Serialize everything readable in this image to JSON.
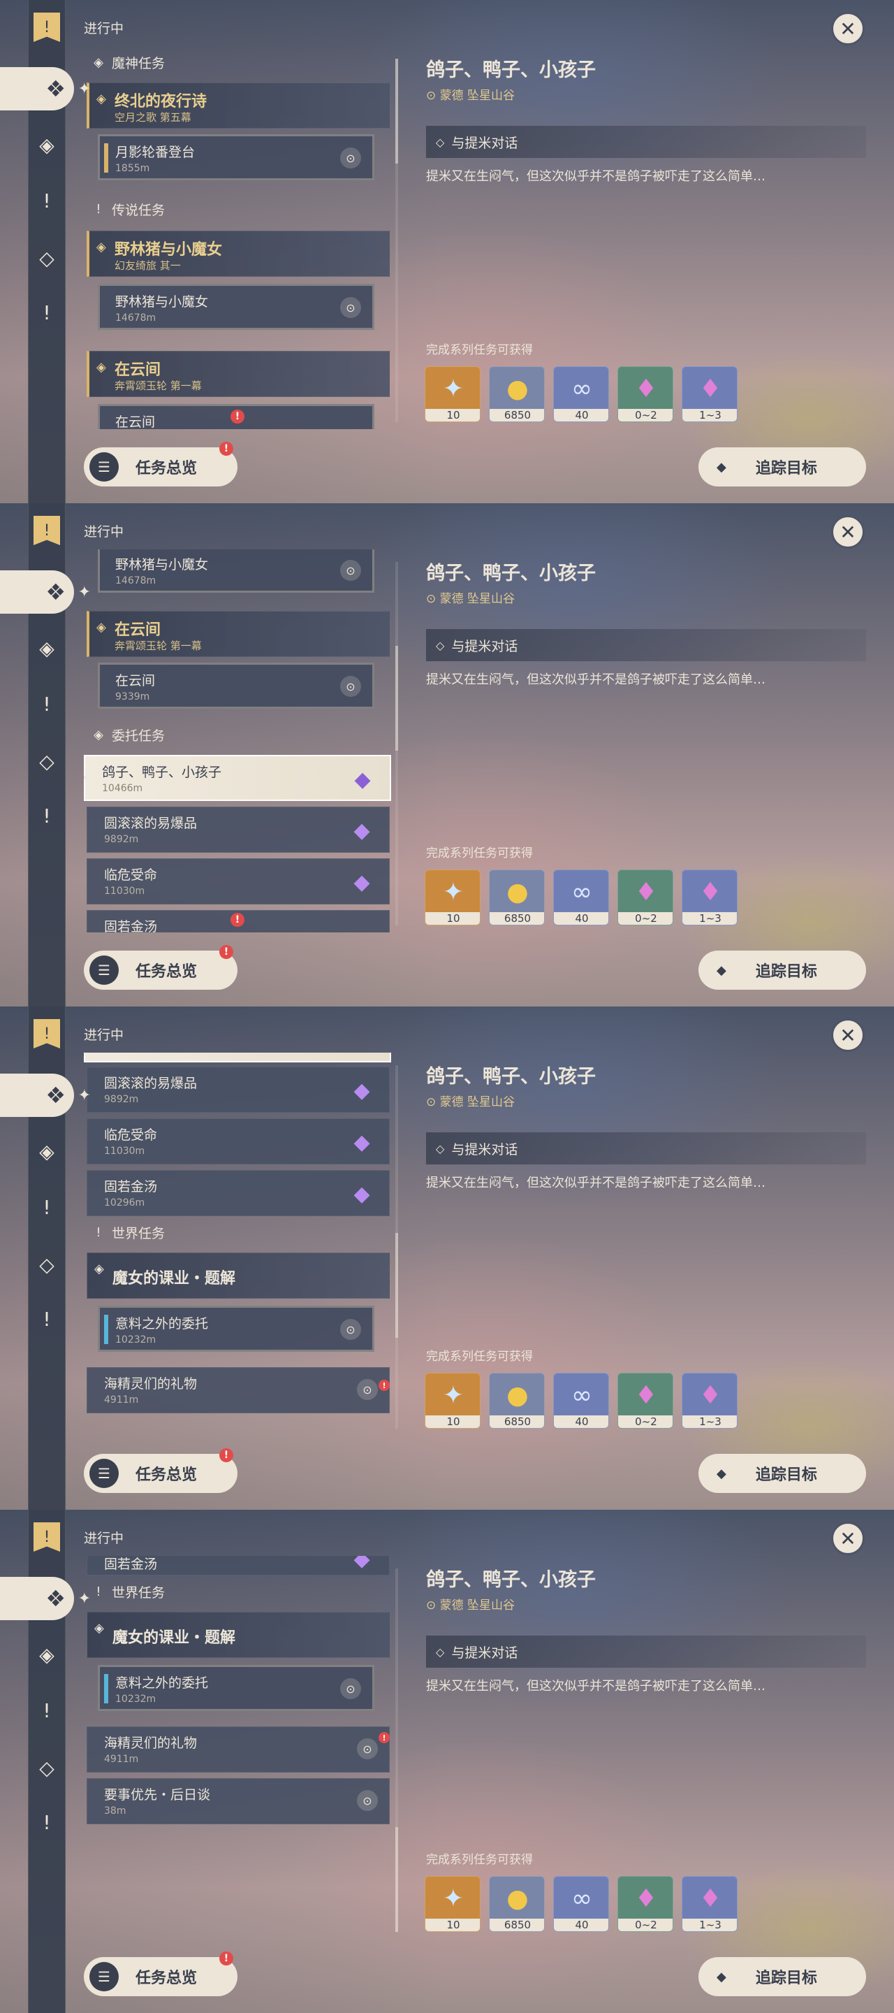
{
  "header": {
    "ongoing": "进行中"
  },
  "categories": {
    "archon": "魔神任务",
    "legend": "传说任务",
    "commission": "委托任务",
    "world": "世界任务"
  },
  "quests": {
    "archon": {
      "title": "终北的夜行诗",
      "subtitle": "空月之歌 第五幕",
      "step": "月影轮番登台",
      "dist": "1855m"
    },
    "legend1": {
      "title": "野林猪与小魔女",
      "subtitle": "幻友绮旅 其一",
      "step": "野林猪与小魔女",
      "dist": "14678m"
    },
    "legend2": {
      "title": "在云间",
      "subtitle": "奔霄颂玉轮 第一幕",
      "step": "在云间",
      "dist": "9339m"
    },
    "commissions": [
      {
        "title": "鸽子、鸭子、小孩子",
        "dist": "10466m"
      },
      {
        "title": "圆滚滚的易爆品",
        "dist": "9892m"
      },
      {
        "title": "临危受命",
        "dist": "11030m"
      },
      {
        "title": "固若金汤",
        "dist": "10296m"
      }
    ],
    "world1": {
      "title": "魔女的课业・题解",
      "step": "意料之外的委托",
      "dist": "10232m"
    },
    "world2": {
      "title": "海精灵们的礼物",
      "dist": "4911m"
    },
    "world3": {
      "title": "要事优先・后日谈",
      "dist": "38m"
    }
  },
  "detail": {
    "title": "鸽子、鸭子、小孩子",
    "location": "蒙德 坠星山谷",
    "objective": "与提米对话",
    "description": "提米又在生闷气，但这次似乎并不是鸽子被吓走了这么简单…",
    "reward_label": "完成系列任务可获得",
    "rewards": [
      {
        "icon": "adventure-exp-icon",
        "count": "10",
        "bg": "#c98a3f"
      },
      {
        "icon": "mora-icon",
        "count": "6850",
        "bg": "#7a86a8"
      },
      {
        "icon": "companionship-icon",
        "count": "40",
        "bg": "#6f7fb6"
      },
      {
        "icon": "crystal-icon",
        "count": "0~2",
        "bg": "#5c8a79"
      },
      {
        "icon": "crystal-cluster-icon",
        "count": "1~3",
        "bg": "#6f7fb6"
      }
    ]
  },
  "buttons": {
    "overview": "任务总览",
    "track": "追踪目标"
  }
}
